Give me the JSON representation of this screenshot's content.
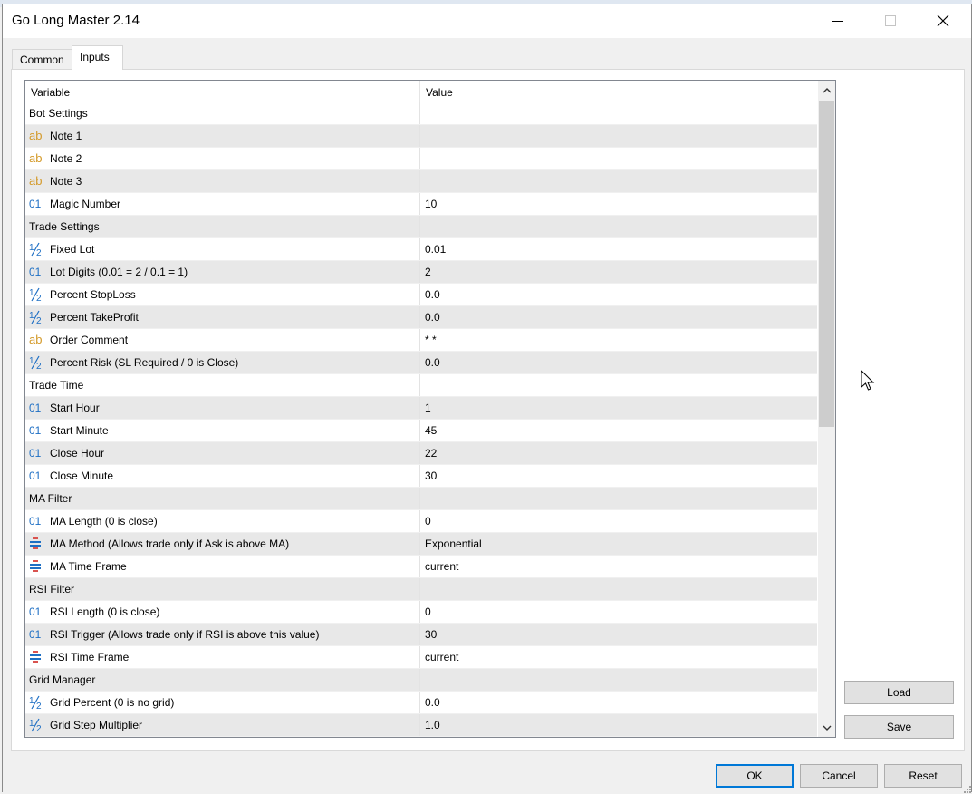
{
  "window": {
    "title": "Go Long Master 2.14"
  },
  "tabs": [
    {
      "label": "Common"
    },
    {
      "label": "Inputs"
    }
  ],
  "grid": {
    "columns": {
      "variable": "Variable",
      "value": "Value"
    },
    "rows": [
      {
        "type": "group",
        "label": "Bot Settings",
        "value": ""
      },
      {
        "type": "string",
        "icon": "ab-string-icon",
        "label": "Note 1",
        "value": ""
      },
      {
        "type": "string",
        "icon": "ab-string-icon",
        "label": "Note 2",
        "value": ""
      },
      {
        "type": "string",
        "icon": "ab-string-icon",
        "label": "Note 3",
        "value": ""
      },
      {
        "type": "int",
        "icon": "integer-icon",
        "label": "Magic Number",
        "value": "10"
      },
      {
        "type": "group",
        "label": "Trade Settings",
        "value": ""
      },
      {
        "type": "double",
        "icon": "fraction-icon",
        "label": "Fixed Lot",
        "value": "0.01"
      },
      {
        "type": "int",
        "icon": "integer-icon",
        "label": "Lot Digits (0.01 = 2 / 0.1 = 1)",
        "value": "2"
      },
      {
        "type": "double",
        "icon": "fraction-icon",
        "label": "Percent StopLoss",
        "value": "0.0"
      },
      {
        "type": "double",
        "icon": "fraction-icon",
        "label": "Percent TakeProfit",
        "value": "0.0"
      },
      {
        "type": "string",
        "icon": "ab-string-icon",
        "label": "Order Comment",
        "value": "* *"
      },
      {
        "type": "double",
        "icon": "fraction-icon",
        "label": "Percent Risk (SL Required / 0 is Close)",
        "value": "0.0"
      },
      {
        "type": "group",
        "label": "Trade Time",
        "value": ""
      },
      {
        "type": "int",
        "icon": "integer-icon",
        "label": "Start Hour",
        "value": "1"
      },
      {
        "type": "int",
        "icon": "integer-icon",
        "label": "Start Minute",
        "value": "45"
      },
      {
        "type": "int",
        "icon": "integer-icon",
        "label": "Close Hour",
        "value": "22"
      },
      {
        "type": "int",
        "icon": "integer-icon",
        "label": "Close Minute",
        "value": "30"
      },
      {
        "type": "group",
        "label": "MA Filter",
        "value": ""
      },
      {
        "type": "int",
        "icon": "integer-icon",
        "label": "MA Length (0 is close)",
        "value": "0"
      },
      {
        "type": "enum",
        "icon": "enum-list-icon",
        "label": "MA Method (Allows trade only if Ask is above MA)",
        "value": "Exponential"
      },
      {
        "type": "enum",
        "icon": "enum-list-icon",
        "label": "MA Time Frame",
        "value": "current"
      },
      {
        "type": "group",
        "label": "RSI Filter",
        "value": ""
      },
      {
        "type": "int",
        "icon": "integer-icon",
        "label": "RSI Length (0 is close)",
        "value": "0"
      },
      {
        "type": "int",
        "icon": "integer-icon",
        "label": "RSI Trigger (Allows trade only if RSI is above this value)",
        "value": "30"
      },
      {
        "type": "enum",
        "icon": "enum-list-icon",
        "label": "RSI Time Frame",
        "value": "current"
      },
      {
        "type": "group",
        "label": "Grid Manager",
        "value": ""
      },
      {
        "type": "double",
        "icon": "fraction-icon",
        "label": "Grid Percent (0 is no grid)",
        "value": "0.0"
      },
      {
        "type": "double",
        "icon": "fraction-icon",
        "label": "Grid Step Multiplier",
        "value": "1.0"
      }
    ]
  },
  "buttons": {
    "load": "Load",
    "save": "Save",
    "ok": "OK",
    "cancel": "Cancel",
    "reset": "Reset"
  },
  "colors": {
    "string_icon": "#d49a2a",
    "numeric_icon": "#1e6fc4",
    "enum_icon_red": "#d9534f",
    "enum_icon_blue": "#1e6fc4",
    "default_button_border": "#0078d7",
    "alt_row": "#e8e8e8"
  }
}
